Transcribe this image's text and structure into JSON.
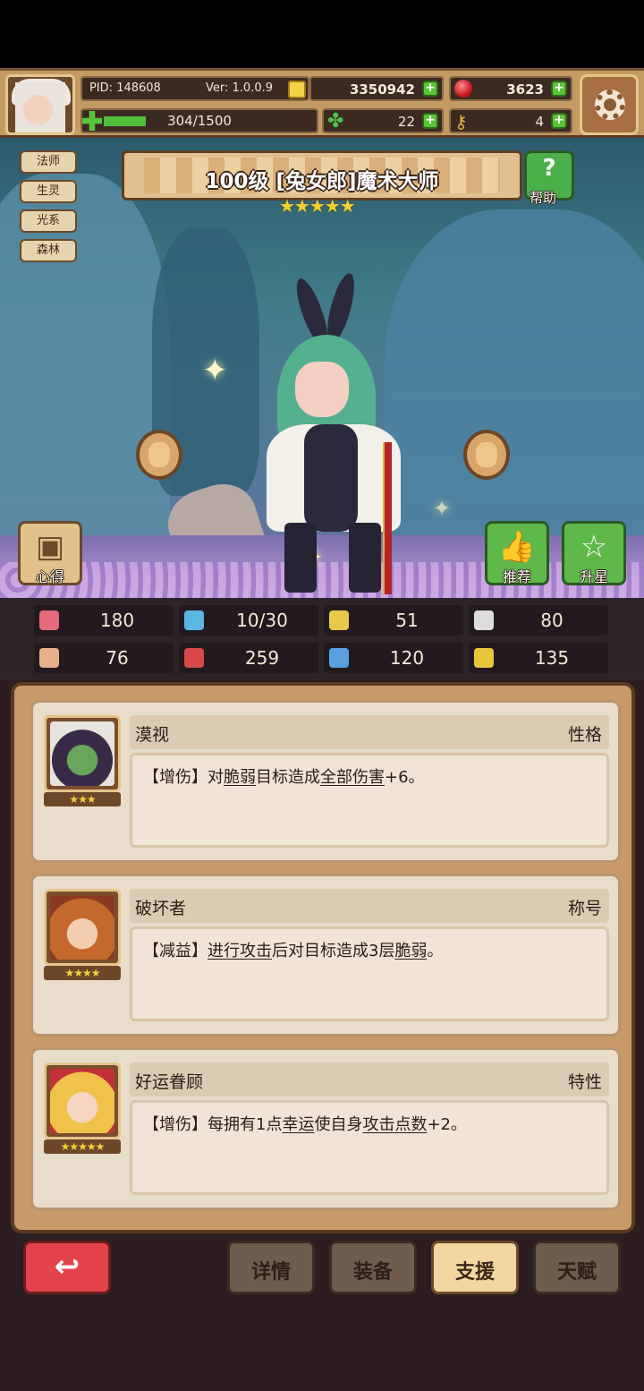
{
  "header": {
    "pid": "PID: 148608",
    "version": "Ver: 1.0.0.9",
    "gold": "3350942",
    "gems": "3623",
    "stamina": "304/1500",
    "stamina_fraction": 0.2,
    "clovers": "22",
    "keys": "4"
  },
  "hero": {
    "tags": [
      "法师",
      "生灵",
      "光系",
      "森林"
    ],
    "title": "100级 [兔女郎]魔术大师",
    "stars": "★★★★★",
    "help_label": "帮助",
    "left_button_label": "心得",
    "recommend_label": "推荐",
    "star_up_label": "升星"
  },
  "stats": [
    {
      "icon": "heart-icon",
      "value": "180",
      "color": "#e56b7a"
    },
    {
      "icon": "water-drop-icon",
      "value": "10/30",
      "color": "#5bb6e3"
    },
    {
      "icon": "shield-icon",
      "value": "51",
      "color": "#e8c94a"
    },
    {
      "icon": "wing-icon",
      "value": "80",
      "color": "#dcdcdc"
    },
    {
      "icon": "fist-icon",
      "value": "76",
      "color": "#e8b08a"
    },
    {
      "icon": "spellbook-icon",
      "value": "259",
      "color": "#d84a4a"
    },
    {
      "icon": "boot-icon",
      "value": "120",
      "color": "#5aa0e0"
    },
    {
      "icon": "horseshoe-icon",
      "value": "135",
      "color": "#e8c63a"
    }
  ],
  "cards": [
    {
      "name": "漠视",
      "type": "性格",
      "stars": "★★★",
      "desc_prefix": "【增伤】对",
      "desc_link1": "脆弱",
      "desc_mid": "目标造成",
      "desc_link2": "全部伤害",
      "desc_suffix": "+6。"
    },
    {
      "name": "破坏者",
      "type": "称号",
      "stars": "★★★★",
      "desc_prefix": "【减益】",
      "desc_link1": "进行攻击",
      "desc_mid": "后对目标造成3层",
      "desc_link2": "脆弱",
      "desc_suffix": "。"
    },
    {
      "name": "好运眷顾",
      "type": "特性",
      "stars": "★★★★★",
      "desc_prefix": "【增伤】每拥有1点",
      "desc_link1": "幸运",
      "desc_mid": "使自身",
      "desc_link2": "攻击点数",
      "desc_suffix": "+2。"
    }
  ],
  "bottom_tabs": {
    "details": "详情",
    "equipment": "装备",
    "support": "支援",
    "talent": "天赋"
  }
}
